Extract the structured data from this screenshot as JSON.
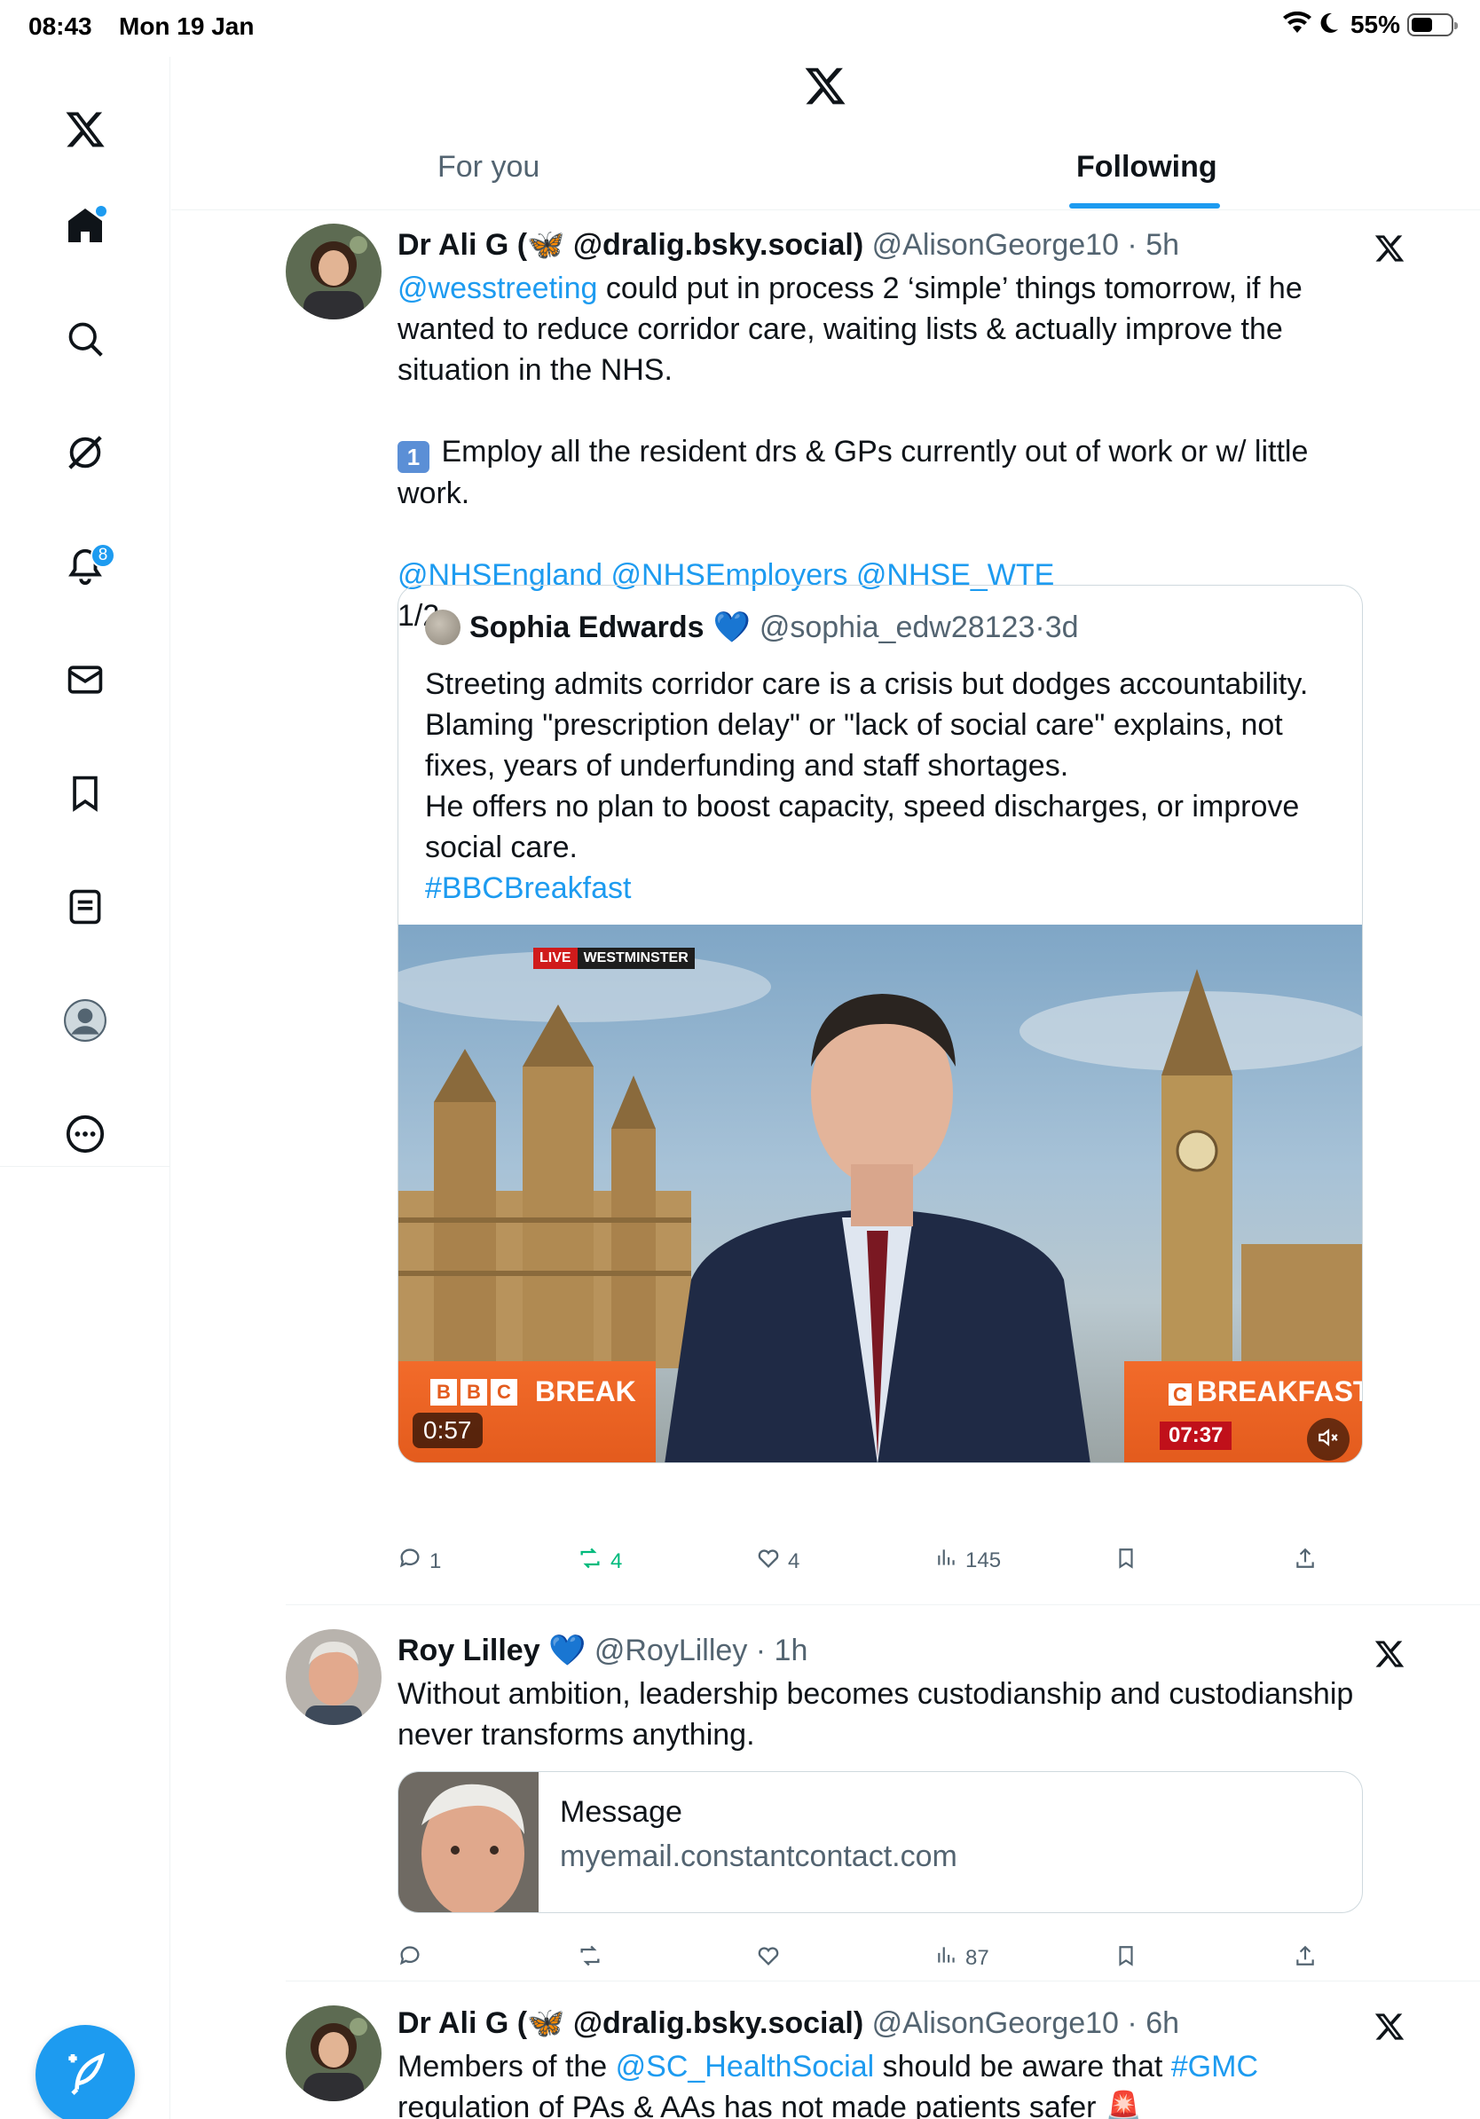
{
  "status_bar": {
    "time": "08:43",
    "date": "Mon 19 Jan",
    "battery": "55%",
    "battery_level": 0.55
  },
  "sidebar": {
    "notifications_count": "8"
  },
  "header": {
    "tabs": [
      {
        "label": "For you",
        "active": false
      },
      {
        "label": "Following",
        "active": true
      }
    ]
  },
  "colors": {
    "accent": "#1d9bf0",
    "text": "#0f1419",
    "muted": "#536471",
    "retweet": "#00ba7c"
  },
  "posts": [
    {
      "author": "Dr Ali G (🦋 @dralig.bsky.social)",
      "handle": "@AlisonGeorge10",
      "time": "5h",
      "mention": "@wesstreeting",
      "text_1": " could put in process 2 ‘simple’ things tomorrow, if he wanted to reduce corridor care, waiting lists & actually improve the situation in the NHS.",
      "emoji_1": "1",
      "text_2": "Employ all the resident drs & GPs currently out of work or w/ little work.",
      "mentions_2": "@NHSEngland @NHSEmployers @NHSE_WTE",
      "thread_marker": "1/2",
      "quote": {
        "author": "Sophia Edwards",
        "author_badge": "💙",
        "handle": "@sophia_edw28123",
        "time": "3d",
        "text": "Streeting admits corridor care is a crisis but dodges accountability. Blaming \"prescription delay\" or \"lack of social care\" explains, not fixes, years of underfunding and staff shortages.\nHe offers no plan to boost capacity, speed discharges, or improve social care.",
        "hashtag": "#BBCBreakfast",
        "video": {
          "live_label": "LIVE",
          "location_label": "WESTMINSTER",
          "bbc_letters": [
            "B",
            "B",
            "C"
          ],
          "brand_left": "BREAK",
          "brand_right": "BREAKFAST",
          "brand_right_prefix": "C",
          "duration": "0:57",
          "clock": "07:37"
        }
      },
      "actions": {
        "replies": "1",
        "reposts": "4",
        "likes": "4",
        "views": "145"
      }
    },
    {
      "author": "Roy Lilley",
      "author_badge": "💙",
      "handle": "@RoyLilley",
      "time": "1h",
      "text": "Without ambition, leadership becomes custodianship and custodianship never transforms anything.",
      "link_card": {
        "title": "Message",
        "domain": "myemail.constantcontact.com"
      },
      "actions": {
        "replies": "",
        "reposts": "",
        "likes": "",
        "views": "87"
      }
    },
    {
      "author": "Dr Ali G (🦋 @dralig.bsky.social)",
      "handle": "@AlisonGeorge10",
      "time": "6h",
      "text_a": "Members of the ",
      "mention": "@SC_HealthSocial",
      "text_b": " should be aware that ",
      "hashtag": "#GMC",
      "text_c": "regulation of PAs & AAs has not made patients safer 🚨"
    }
  ],
  "icons": [
    "x-logo-icon",
    "home-icon",
    "search-icon",
    "grok-icon",
    "bell-icon",
    "mail-icon",
    "bookmark-icon",
    "lists-icon",
    "profile-icon",
    "more-icon",
    "compose-icon",
    "reply-icon",
    "repost-icon",
    "like-icon",
    "views-icon",
    "share-icon",
    "mute-icon",
    "wifi-icon",
    "moon-icon"
  ]
}
